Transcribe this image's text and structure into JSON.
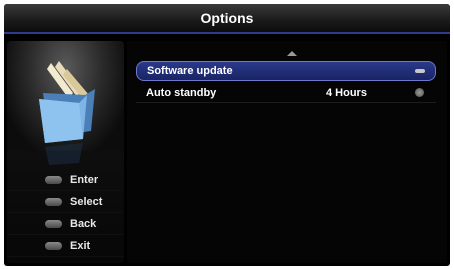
{
  "header": {
    "title": "Options"
  },
  "legend": [
    {
      "label": "Enter",
      "icon": "ok-key-icon"
    },
    {
      "label": "Select",
      "icon": "select-key-icon"
    },
    {
      "label": "Back",
      "icon": "back-key-icon"
    },
    {
      "label": "Exit",
      "icon": "exit-key-icon"
    }
  ],
  "menu": {
    "items": [
      {
        "label": "Software update",
        "value": "",
        "selected": true,
        "indicator": "more-icon"
      },
      {
        "label": "Auto standby",
        "value": "4 Hours",
        "selected": false,
        "indicator": "ok-icon"
      }
    ]
  },
  "colors": {
    "selection": "#1e2a78",
    "title_underline": "#2f3b8c",
    "folder": "#6fa8dc"
  }
}
